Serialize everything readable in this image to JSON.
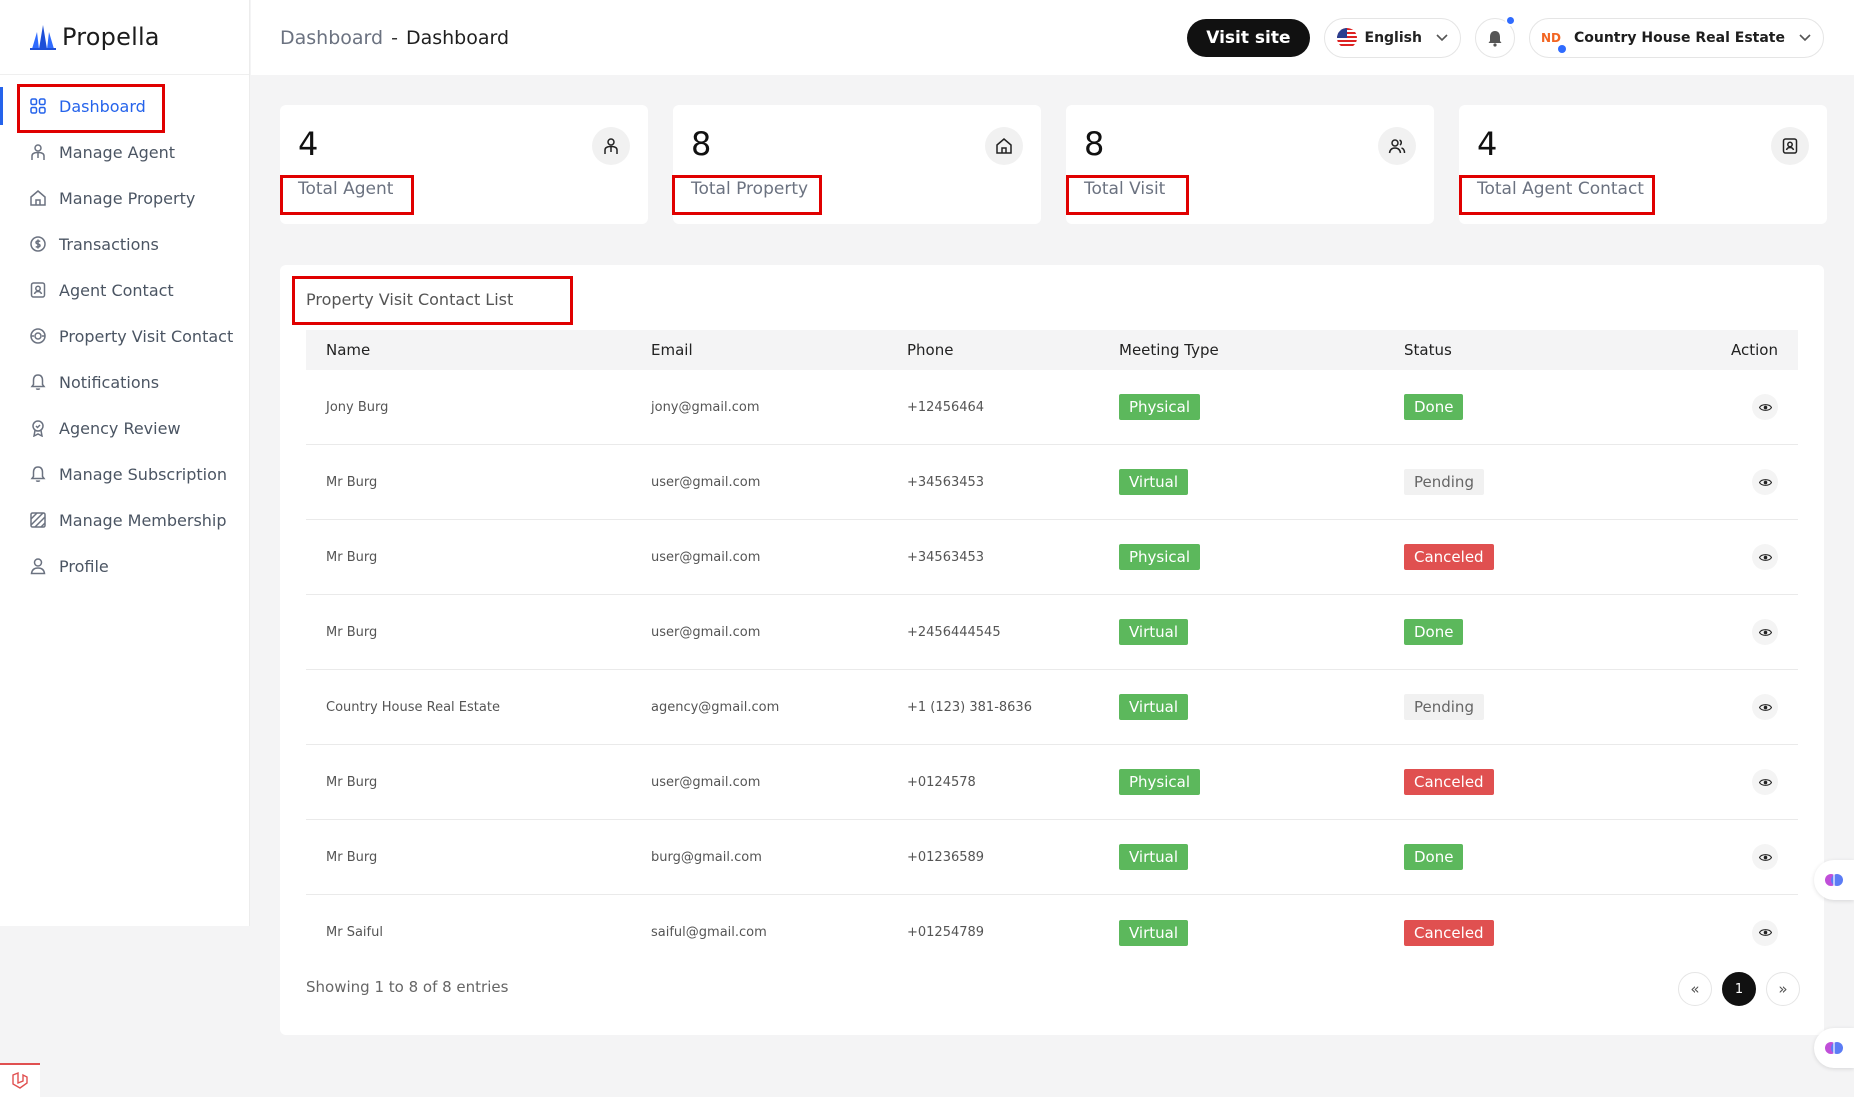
{
  "brand": {
    "name": "Propella"
  },
  "header": {
    "breadcrumb_parent": "Dashboard",
    "breadcrumb_sep": "-",
    "breadcrumb_current": "Dashboard",
    "visit_site": "Visit site",
    "language": "English",
    "account_name": "Country House Real Estate",
    "account_logo": "ND"
  },
  "sidebar": {
    "items": [
      {
        "label": "Dashboard",
        "icon": "grid-icon",
        "active": true
      },
      {
        "label": "Manage Agent",
        "icon": "agent-icon"
      },
      {
        "label": "Manage Property",
        "icon": "home-icon"
      },
      {
        "label": "Transactions",
        "icon": "dollar-icon"
      },
      {
        "label": "Agent Contact",
        "icon": "contact-icon"
      },
      {
        "label": "Property Visit Contact",
        "icon": "visit-icon"
      },
      {
        "label": "Notifications",
        "icon": "bell-icon"
      },
      {
        "label": "Agency Review",
        "icon": "badge-icon"
      },
      {
        "label": "Manage Subscription",
        "icon": "bell-icon"
      },
      {
        "label": "Manage Membership",
        "icon": "membership-icon"
      },
      {
        "label": "Profile",
        "icon": "user-icon"
      }
    ]
  },
  "stats": [
    {
      "value": "4",
      "label": "Total Agent",
      "icon": "agent-icon"
    },
    {
      "value": "8",
      "label": "Total Property",
      "icon": "home-icon"
    },
    {
      "value": "8",
      "label": "Total Visit",
      "icon": "users-icon"
    },
    {
      "value": "4",
      "label": "Total Agent Contact",
      "icon": "contact-icon"
    }
  ],
  "table": {
    "title": "Property Visit Contact List",
    "columns": [
      "Name",
      "Email",
      "Phone",
      "Meeting Type",
      "Status",
      "Action"
    ],
    "rows": [
      {
        "name": "Jony Burg",
        "email": "jony@gmail.com",
        "phone": "+12456464",
        "meeting": "Physical",
        "status": "Done"
      },
      {
        "name": "Mr Burg",
        "email": "user@gmail.com",
        "phone": "+34563453",
        "meeting": "Virtual",
        "status": "Pending"
      },
      {
        "name": "Mr Burg",
        "email": "user@gmail.com",
        "phone": "+34563453",
        "meeting": "Physical",
        "status": "Canceled"
      },
      {
        "name": "Mr Burg",
        "email": "user@gmail.com",
        "phone": "+2456444545",
        "meeting": "Virtual",
        "status": "Done"
      },
      {
        "name": "Country House Real Estate",
        "email": "agency@gmail.com",
        "phone": "+1 (123) 381-8636",
        "meeting": "Virtual",
        "status": "Pending"
      },
      {
        "name": "Mr Burg",
        "email": "user@gmail.com",
        "phone": "+0124578",
        "meeting": "Physical",
        "status": "Canceled"
      },
      {
        "name": "Mr Burg",
        "email": "burg@gmail.com",
        "phone": "+01236589",
        "meeting": "Virtual",
        "status": "Done"
      },
      {
        "name": "Mr Saiful",
        "email": "saiful@gmail.com",
        "phone": "+01254789",
        "meeting": "Virtual",
        "status": "Canceled"
      }
    ],
    "showing": "Showing 1 to 8 of 8 entries",
    "pagination": {
      "prev": "«",
      "current": "1",
      "next": "»"
    }
  },
  "colors": {
    "accent": "#2563eb",
    "status_green": "#5cb85c",
    "status_red": "#e05050",
    "highlight_red": "#e00000"
  }
}
